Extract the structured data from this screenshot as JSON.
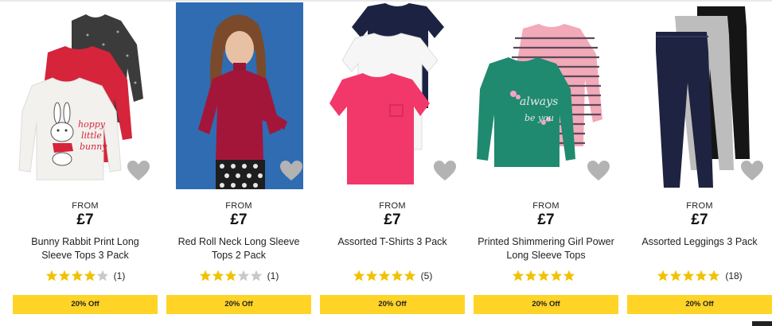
{
  "colors": {
    "accent": "#ffd426",
    "star_filled": "#f2c100",
    "star_empty": "#c9c9c9",
    "heart": "#b3b3b3"
  },
  "products": [
    {
      "from_label": "FROM",
      "price": "£7",
      "name": "Bunny Rabbit Print Long Sleeve Tops 3 Pack",
      "rating": 4,
      "review_count": "(1)",
      "badge": "20% Off",
      "image_text": [
        "hoppy",
        "little",
        "bunny"
      ],
      "icon": "heart-icon"
    },
    {
      "from_label": "FROM",
      "price": "£7",
      "name": "Red Roll Neck Long Sleeve Tops 2 Pack",
      "rating": 3,
      "review_count": "(1)",
      "badge": "20% Off",
      "icon": "heart-icon"
    },
    {
      "from_label": "FROM",
      "price": "£7",
      "name": "Assorted T-Shirts 3 Pack",
      "rating": 5,
      "review_count": "(5)",
      "badge": "20% Off",
      "icon": "heart-icon"
    },
    {
      "from_label": "FROM",
      "price": "£7",
      "name": "Printed Shimmering Girl Power Long Sleeve Tops",
      "rating": 5,
      "review_count": "",
      "badge": "20% Off",
      "image_text": [
        "always",
        "be you"
      ],
      "icon": "heart-icon"
    },
    {
      "from_label": "FROM",
      "price": "£7",
      "name": "Assorted Leggings 3 Pack",
      "rating": 5,
      "review_count": "(18)",
      "badge": "20% Off",
      "icon": "heart-icon"
    }
  ]
}
